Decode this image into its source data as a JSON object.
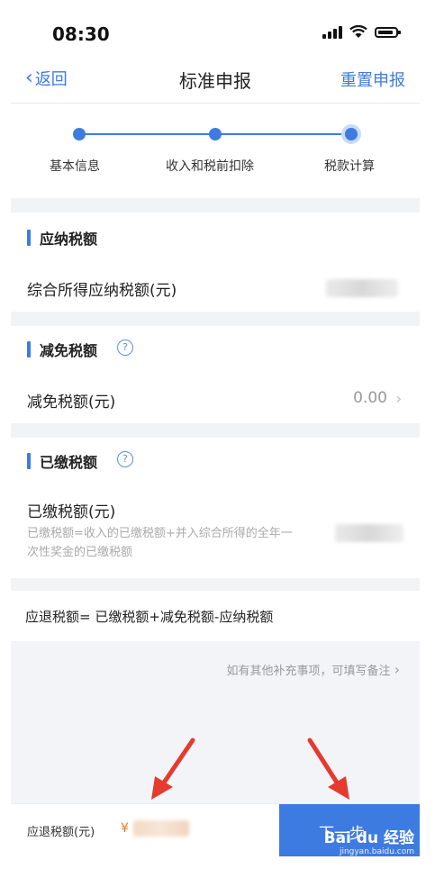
{
  "status_bar": {
    "time": "08:30"
  },
  "nav": {
    "back_label": "返回",
    "title": "标准申报",
    "right_label": "重置申报"
  },
  "steps": [
    {
      "label": "基本信息"
    },
    {
      "label": "收入和税前扣除"
    },
    {
      "label": "税款计算"
    }
  ],
  "current_step": 3,
  "sections": {
    "payable": {
      "title": "应纳税额",
      "row_label": "综合所得应纳税额(元)"
    },
    "reduction": {
      "title": "减免税额",
      "row_label": "减免税额(元)",
      "row_value": "0.00"
    },
    "paid": {
      "title": "已缴税额",
      "row_label": "已缴税额(元)",
      "desc_line1": "已缴税额=收入的已缴税额+并入综合所得的全年一",
      "desc_line2": "次性奖金的已缴税额"
    }
  },
  "formula": "应退税额= 已缴税额+减免税额-应纳税额",
  "remark_placeholder": "如有其他补充事项，可填写备注",
  "bottom_bar": {
    "refund_label": "应退税额(元)",
    "currency": "¥",
    "next_label": "下一步"
  },
  "watermark": {
    "main": "Bai du 经验",
    "sub": "jingyan.baidu.com"
  },
  "colors": {
    "accent": "#3d7be0",
    "arrow": "#e53b2e",
    "currency": "#e87b1a"
  }
}
